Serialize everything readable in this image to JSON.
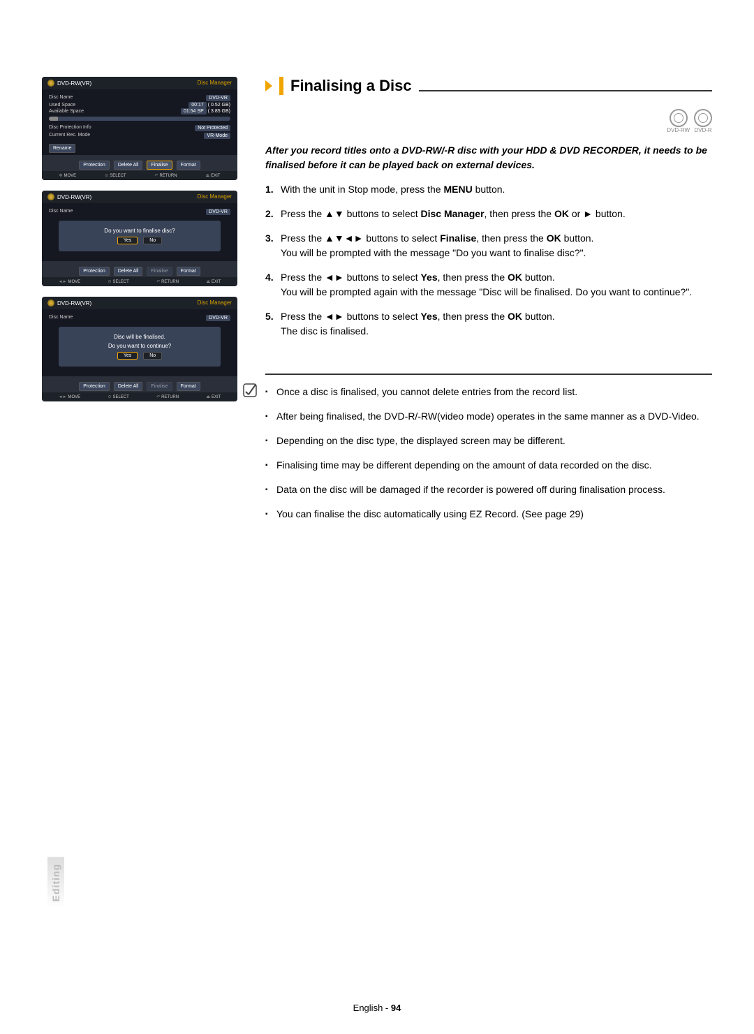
{
  "section": {
    "title": "Finalising a Disc",
    "intro": "After you record titles onto a DVD-RW/-R disc with your HDD & DVD RECORDER, it needs to be finalised before it can be played back on external devices.",
    "steps": [
      {
        "pre": "With the unit in Stop mode, press the ",
        "bold": "MENU",
        "post": " button."
      },
      {
        "pre": "Press the ▲▼ buttons to select ",
        "bold": "Disc Manager",
        "post": ", then press the ",
        "bold2": "OK",
        "post2": " or ► button."
      },
      {
        "pre": "Press the ▲▼◄► buttons to select ",
        "bold": "Finalise",
        "post": ", then press the ",
        "bold2": "OK",
        "post2": " button.",
        "extra": "You will be prompted with the message \"Do you want to finalise disc?\"."
      },
      {
        "pre": "Press the ◄► buttons to select ",
        "bold": "Yes",
        "post": ", then press the ",
        "bold2": "OK",
        "post2": " button.",
        "extra": "You will be prompted again with the message \"Disc will be finalised. Do you want to continue?\"."
      },
      {
        "pre": "Press the ◄► buttons to select ",
        "bold": "Yes",
        "post": ", then press the ",
        "bold2": "OK",
        "post2": " button.",
        "extra": "The disc is finalised."
      }
    ],
    "notes": [
      "Once a disc is finalised, you cannot delete entries from the record list.",
      "After being finalised, the DVD-R/-RW(video mode) operates in the same manner as a DVD-Video.",
      "Depending on the disc type, the displayed screen may be different.",
      "Finalising time may be different depending on the amount of data recorded on the disc.",
      "Data on the disc will be damaged if the recorder is powered off during finalisation process.",
      "You can finalise the disc automatically using EZ Record. (See page 29)"
    ]
  },
  "disc_types": [
    "DVD-RW",
    "DVD-R"
  ],
  "panel": {
    "device": "DVD-RW(VR)",
    "header_right": "Disc Manager",
    "fields": {
      "disc_name_label": "Disc Name",
      "disc_name_value": "DVD-VR",
      "used_label": "Used Space",
      "used_time": "00:17",
      "used_size": "( 0.52 GB)",
      "avail_label": "Available Space",
      "avail_time": "01:54 SP",
      "avail_size": "( 3.85 GB)",
      "prot_label": "Disc Protection Info",
      "prot_value": "Not Protected",
      "mode_label": "Current Rec. Mode",
      "mode_value": "VR-Mode"
    },
    "rename": "Rename",
    "buttons": {
      "protection": "Protection",
      "delete_all": "Delete All",
      "finalise": "Finalise",
      "format": "Format"
    },
    "footer": {
      "move": "MOVE",
      "select": "SELECT",
      "ret": "RETURN",
      "exit": "EXIT"
    },
    "dialog1": "Do you want to finalise disc?",
    "dialog2a": "Disc will be finalised.",
    "dialog2b": "Do you want to continue?",
    "yes": "Yes",
    "no": "No"
  },
  "side_tab": "Editing",
  "footer": {
    "lang": "English",
    "page": "94"
  }
}
